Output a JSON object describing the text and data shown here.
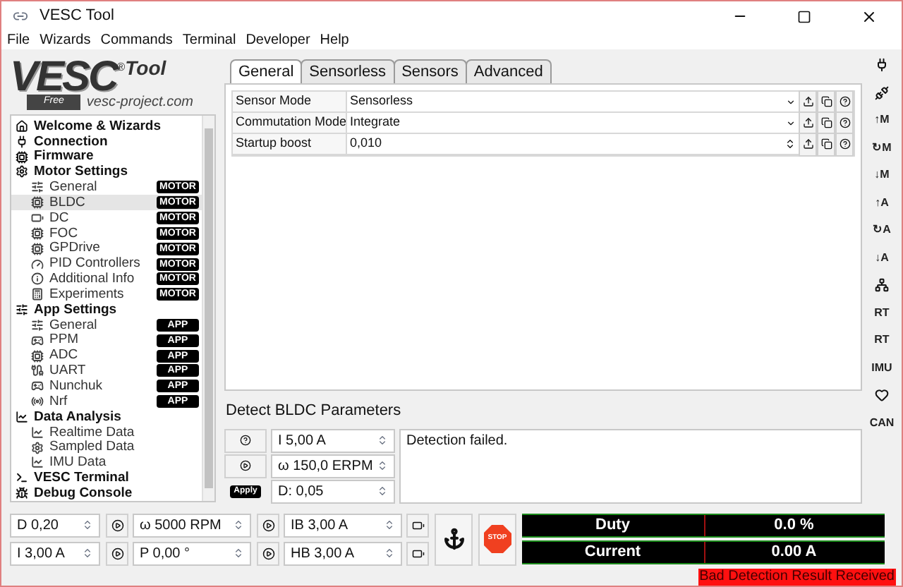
{
  "window": {
    "title": "VESC Tool"
  },
  "menu": [
    "File",
    "Wizards",
    "Commands",
    "Terminal",
    "Developer",
    "Help"
  ],
  "logo": {
    "main": "VESC",
    "registered": "®",
    "tool": "Tool",
    "free": "Free",
    "site": "vesc-project.com"
  },
  "tree": [
    {
      "label": "Welcome & Wizards"
    },
    {
      "label": "Connection"
    },
    {
      "label": "Firmware"
    },
    {
      "label": "Motor Settings",
      "children": [
        {
          "label": "General",
          "badge": "MOTOR",
          "selected": false
        },
        {
          "label": "BLDC",
          "badge": "MOTOR",
          "selected": true
        },
        {
          "label": "DC",
          "badge": "MOTOR",
          "selected": false
        },
        {
          "label": "FOC",
          "badge": "MOTOR",
          "selected": false
        },
        {
          "label": "GPDrive",
          "badge": "MOTOR",
          "selected": false
        },
        {
          "label": "PID Controllers",
          "badge": "MOTOR",
          "selected": false
        },
        {
          "label": "Additional Info",
          "badge": "MOTOR",
          "selected": false
        },
        {
          "label": "Experiments",
          "badge": "MOTOR",
          "selected": false
        }
      ]
    },
    {
      "label": "App Settings",
      "children": [
        {
          "label": "General",
          "badge": "APP",
          "selected": false
        },
        {
          "label": "PPM",
          "badge": "APP",
          "selected": false
        },
        {
          "label": "ADC",
          "badge": "APP",
          "selected": false
        },
        {
          "label": "UART",
          "badge": "APP",
          "selected": false
        },
        {
          "label": "Nunchuk",
          "badge": "APP",
          "selected": false
        },
        {
          "label": "Nrf",
          "badge": "APP",
          "selected": false
        }
      ]
    },
    {
      "label": "Data Analysis",
      "children": [
        {
          "label": "Realtime Data",
          "selected": false
        },
        {
          "label": "Sampled Data",
          "selected": false
        },
        {
          "label": "IMU Data",
          "selected": false
        }
      ]
    },
    {
      "label": "VESC Terminal"
    },
    {
      "label": "Debug Console"
    }
  ],
  "tabs": [
    {
      "label": "General",
      "selected": true
    },
    {
      "label": "Sensorless",
      "selected": false
    },
    {
      "label": "Sensors",
      "selected": false
    },
    {
      "label": "Advanced",
      "selected": false
    }
  ],
  "parameters": [
    {
      "label": "Sensor Mode",
      "value": "Sensorless",
      "kind": "combo"
    },
    {
      "label": "Commutation Mode",
      "value": "Integrate",
      "kind": "combo"
    },
    {
      "label": "Startup boost",
      "value": "0,010",
      "kind": "spin"
    }
  ],
  "detect": {
    "title": "Detect BLDC Parameters",
    "apply": "Apply",
    "fields": [
      "I 5,00 A",
      "ω 150,0 ERPM",
      "D: 0,05"
    ],
    "output": "Detection failed."
  },
  "controls": [
    [
      "D 0,20",
      "ω 5000 RPM",
      "IB 3,00 A"
    ],
    [
      "I 3,00 A",
      "P 0,00 °",
      "HB 3,00 A"
    ]
  ],
  "stop_label": "STOP",
  "gauges": [
    {
      "label": "Duty",
      "value": "0.0 %"
    },
    {
      "label": "Current",
      "value": "0.00 A"
    }
  ],
  "toolbar": [
    {
      "kind": "plug"
    },
    {
      "kind": "unplug"
    },
    {
      "kind": "text",
      "label": "↑M"
    },
    {
      "kind": "text",
      "label": "↻M"
    },
    {
      "kind": "text",
      "label": "↓M"
    },
    {
      "kind": "text",
      "label": "↑A"
    },
    {
      "kind": "text",
      "label": "↻A"
    },
    {
      "kind": "text",
      "label": "↓A"
    },
    {
      "kind": "network"
    },
    {
      "kind": "text",
      "label": "RT"
    },
    {
      "kind": "text",
      "label": "RT"
    },
    {
      "kind": "text",
      "label": "IMU"
    },
    {
      "kind": "heart"
    },
    {
      "kind": "text",
      "label": "CAN"
    }
  ],
  "status": "Bad Detection Result Received"
}
